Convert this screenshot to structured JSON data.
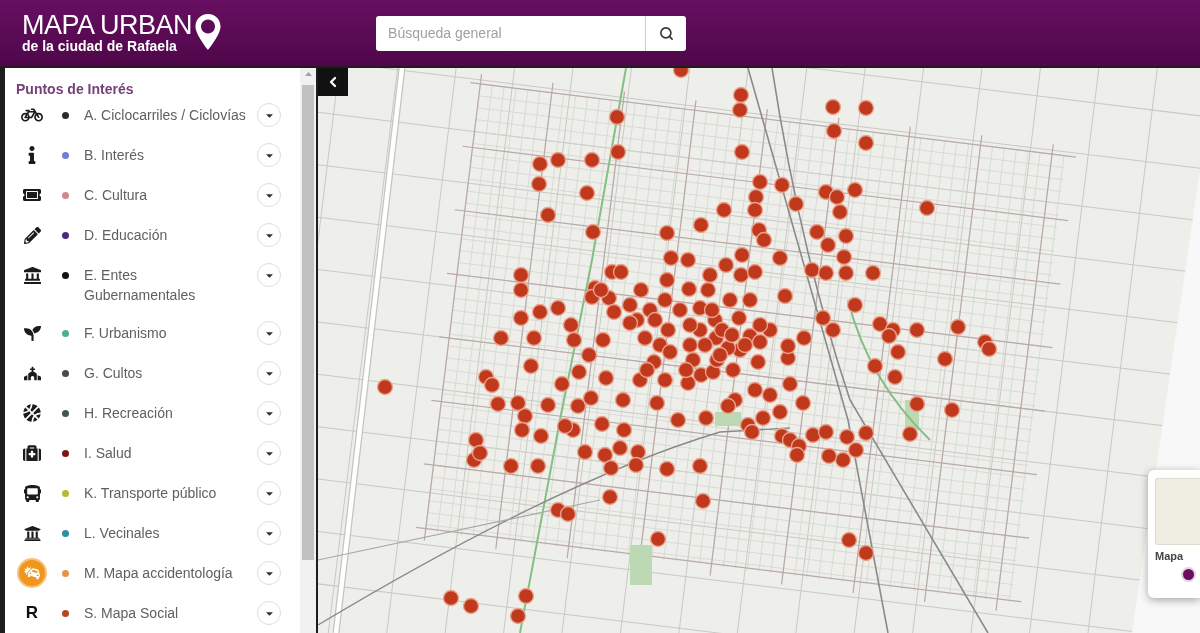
{
  "header": {
    "title": "MAPA URBAN",
    "subtitle": "de la ciudad de Rafaela"
  },
  "search": {
    "placeholder": "Búsqueda general"
  },
  "sidebar": {
    "title": "Puntos de Interés",
    "items": [
      {
        "label": "A. Ciclocarriles / Ciclovías",
        "color": "#2b2b2b",
        "expanded": false
      },
      {
        "label": "B. Interés",
        "color": "#6f7fd6",
        "expanded": false
      },
      {
        "label": "C. Cultura",
        "color": "#cc8a8a",
        "expanded": false
      },
      {
        "label": "D. Educación",
        "color": "#4b2a7a",
        "expanded": false
      },
      {
        "label": "E. Entes Gubernamentales",
        "color": "#111111",
        "expanded": false
      },
      {
        "label": "F. Urbanismo",
        "color": "#48b08a",
        "expanded": false
      },
      {
        "label": "G. Cultos",
        "color": "#4a4a4a",
        "expanded": false
      },
      {
        "label": "H. Recreación",
        "color": "#45564f",
        "expanded": false
      },
      {
        "label": "I. Salud",
        "color": "#7d1414",
        "expanded": false
      },
      {
        "label": "K. Transporte público",
        "color": "#b9b934",
        "expanded": false
      },
      {
        "label": "L. Vecinales",
        "color": "#2c8ea3",
        "expanded": false
      },
      {
        "label": "M. Mapa accidentología",
        "color": "#e3944a",
        "expanded": false
      },
      {
        "label": "S. Mapa Social",
        "color": "#b4472a",
        "expanded": false,
        "icon_glyph": "R"
      }
    ]
  },
  "basemap_card": {
    "label": "Mapa",
    "selected": true
  }
}
